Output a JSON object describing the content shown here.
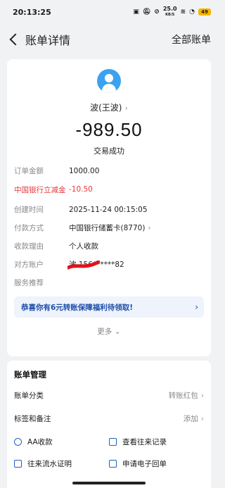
{
  "status_bar": {
    "time": "20:13:25",
    "net_speed": "25.0",
    "net_unit": "KB/S",
    "battery": "49"
  },
  "nav": {
    "title": "账单详情",
    "right_action": "全部账单"
  },
  "detail": {
    "payee": "波(王波)",
    "amount": "-989.50",
    "trade_status": "交易成功",
    "rows": {
      "order_amount_label": "订单金额",
      "order_amount_value": "1000.00",
      "discount_label": "中国银行立减金",
      "discount_value": "-10.50",
      "created_label": "创建时间",
      "created_value": "2025-11-24 00:15:05",
      "pay_method_label": "付款方式",
      "pay_method_value": "中国银行储蓄卡(8770)",
      "reason_label": "收款理由",
      "reason_value": "个人收款",
      "counterparty_label": "对方账户",
      "counterparty_value": "波 156******82",
      "service_label": "服务推荐"
    },
    "promo_text": "恭喜你有6元转账保障福利待领取!",
    "more_label": "更多"
  },
  "manage": {
    "title": "账单管理",
    "category_label": "账单分类",
    "category_value": "转账红包",
    "tags_label": "标签和备注",
    "tags_value": "添加",
    "actions": {
      "aa": "AA收款",
      "records": "查看往来记录",
      "flow_proof": "往来流水证明",
      "e_receipt": "申请电子回单"
    }
  },
  "colors": {
    "accent_blue": "#1f5fc4",
    "red": "#e5383b",
    "avatar_blue": "#3aa3f0"
  },
  "icons": [
    "back-arrow-icon",
    "chevron-right-icon",
    "user-avatar-icon",
    "battery-icon",
    "wifi-icon"
  ]
}
